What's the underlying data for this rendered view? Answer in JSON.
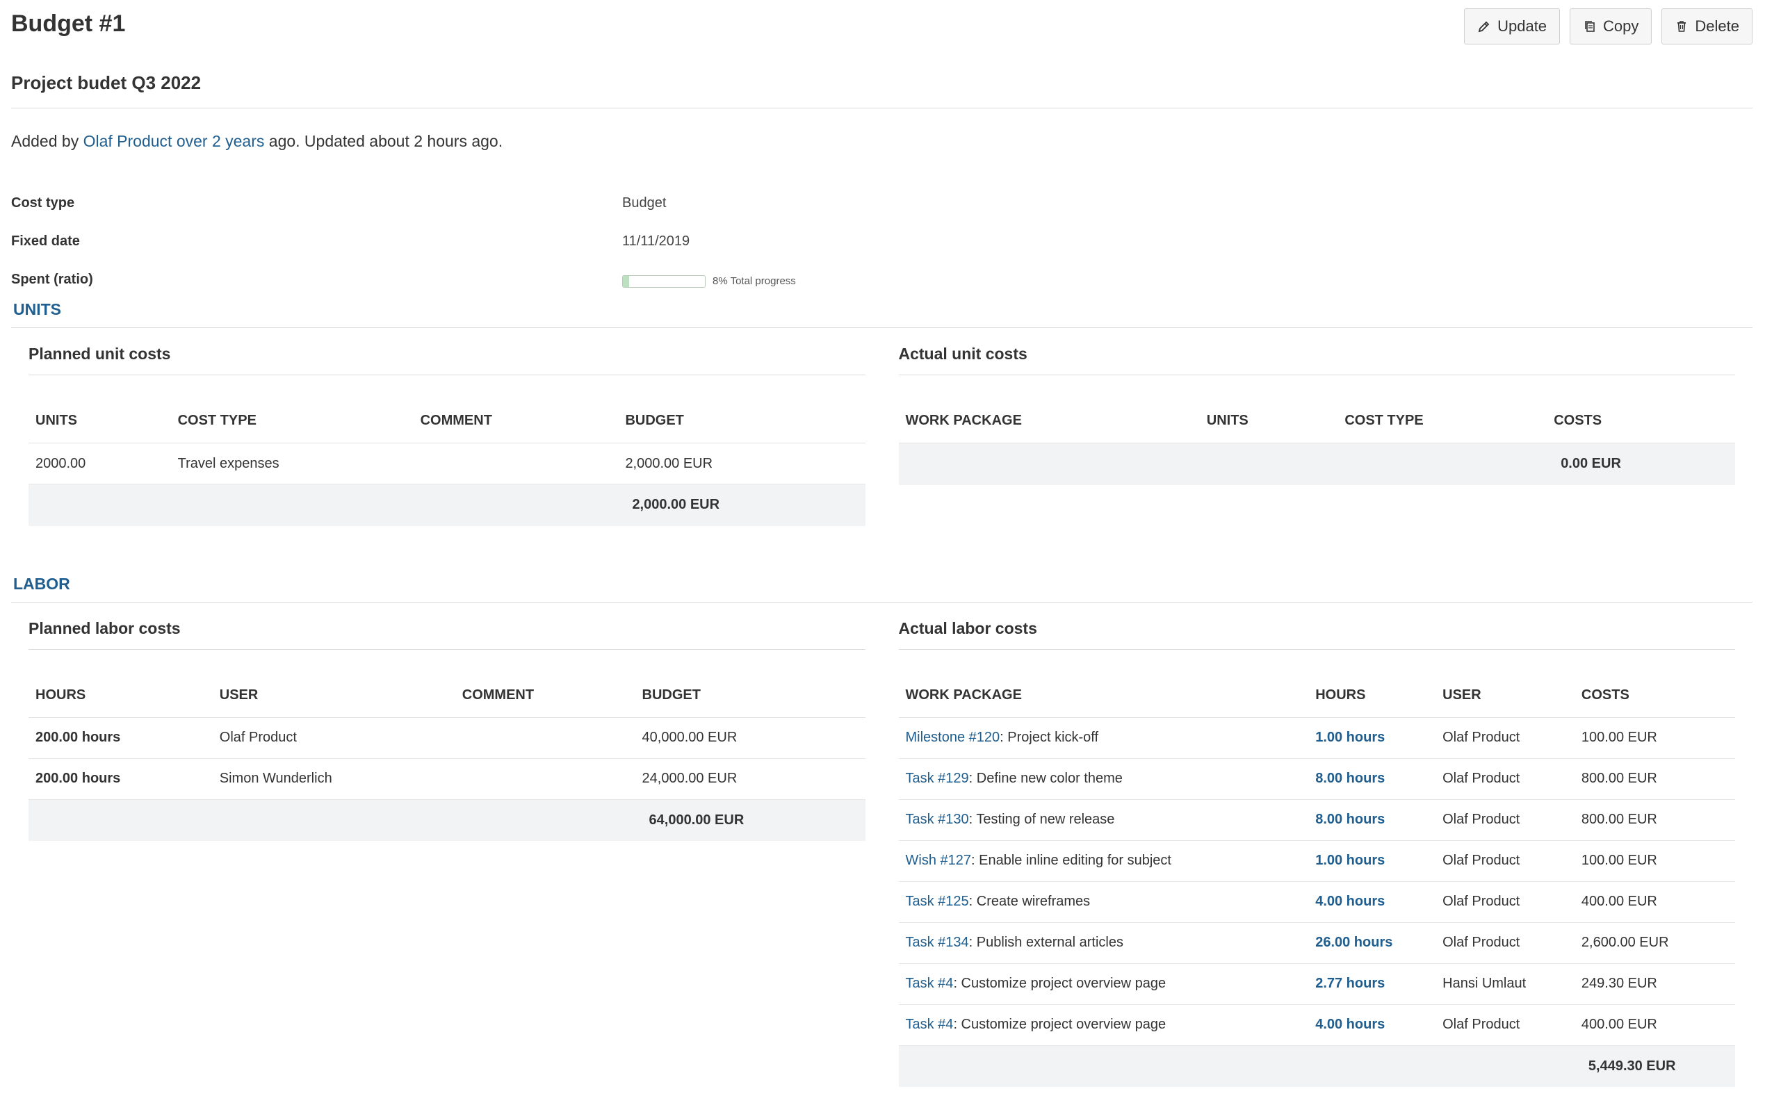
{
  "header": {
    "title": "Budget #1",
    "update_label": "Update",
    "copy_label": "Copy",
    "delete_label": "Delete"
  },
  "subtitle": "Project budet Q3 2022",
  "meta": {
    "added_by_prefix": "Added by ",
    "author": "Olaf Product",
    "space": " ",
    "added_ago": "over 2 years",
    "suffix": " ago. Updated about 2 hours ago."
  },
  "attributes": {
    "cost_type_label": "Cost type",
    "cost_type_value": "Budget",
    "fixed_date_label": "Fixed date",
    "fixed_date_value": "11/11/2019",
    "spent_label": "Spent (ratio)",
    "spent_percent": 8,
    "spent_text": "8% Total progress"
  },
  "units": {
    "section_title": "UNITS",
    "planned": {
      "title": "Planned unit costs",
      "headers": [
        "UNITS",
        "COST TYPE",
        "COMMENT",
        "BUDGET"
      ],
      "rows": [
        {
          "units": "2000.00",
          "cost_type": "Travel expenses",
          "comment": "",
          "budget": "2,000.00 EUR"
        }
      ],
      "total": "2,000.00 EUR"
    },
    "actual": {
      "title": "Actual unit costs",
      "headers": [
        "WORK PACKAGE",
        "UNITS",
        "COST TYPE",
        "COSTS"
      ],
      "total": "0.00 EUR"
    }
  },
  "labor": {
    "section_title": "LABOR",
    "planned": {
      "title": "Planned labor costs",
      "headers": [
        "HOURS",
        "USER",
        "COMMENT",
        "BUDGET"
      ],
      "rows": [
        {
          "hours": "200.00 hours",
          "user": "Olaf Product",
          "comment": "",
          "budget": "40,000.00 EUR"
        },
        {
          "hours": "200.00 hours",
          "user": "Simon Wunderlich",
          "comment": "",
          "budget": "24,000.00 EUR"
        }
      ],
      "total": "64,000.00 EUR"
    },
    "actual": {
      "title": "Actual labor costs",
      "headers": [
        "WORK PACKAGE",
        "HOURS",
        "USER",
        "COSTS"
      ],
      "rows": [
        {
          "wp_link": "Milestone #120",
          "wp_subject": ": Project kick-off",
          "hours": "1.00 hours",
          "user": "Olaf Product",
          "costs": "100.00 EUR"
        },
        {
          "wp_link": "Task #129",
          "wp_subject": ": Define new color theme",
          "hours": "8.00 hours",
          "user": "Olaf Product",
          "costs": "800.00 EUR"
        },
        {
          "wp_link": "Task #130",
          "wp_subject": ": Testing of new release",
          "hours": "8.00 hours",
          "user": "Olaf Product",
          "costs": "800.00 EUR"
        },
        {
          "wp_link": "Wish #127",
          "wp_subject": ": Enable inline editing for subject",
          "hours": "1.00 hours",
          "user": "Olaf Product",
          "costs": "100.00 EUR"
        },
        {
          "wp_link": "Task #125",
          "wp_subject": ": Create wireframes",
          "hours": "4.00 hours",
          "user": "Olaf Product",
          "costs": "400.00 EUR"
        },
        {
          "wp_link": "Task #134",
          "wp_subject": ": Publish external articles",
          "hours": "26.00 hours",
          "user": "Olaf Product",
          "costs": "2,600.00 EUR"
        },
        {
          "wp_link": "Task #4",
          "wp_subject": ": Customize project overview page",
          "hours": "2.77 hours",
          "user": "Hansi Umlaut",
          "costs": "249.30 EUR"
        },
        {
          "wp_link": "Task #4",
          "wp_subject": ": Customize project overview page",
          "hours": "4.00 hours",
          "user": "Olaf Product",
          "costs": "400.00 EUR"
        }
      ],
      "total": "5,449.30 EUR"
    }
  }
}
